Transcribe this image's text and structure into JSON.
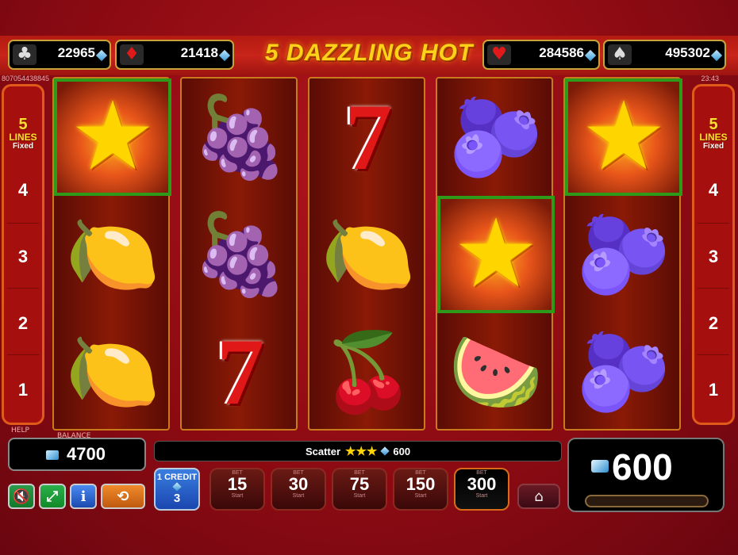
{
  "title": "5 DAZZLING HOT",
  "jackpots": [
    {
      "suit": "club",
      "icon": "♣",
      "value": "22965"
    },
    {
      "suit": "diamond",
      "icon": "♦",
      "value": "21418"
    },
    {
      "suit": "heart",
      "icon": "♥",
      "value": "284586"
    },
    {
      "suit": "spade",
      "icon": "♠",
      "value": "495302"
    }
  ],
  "top_left_id": "807054438845",
  "clock": "23:43",
  "side": {
    "lines_count": "5",
    "lines_word": "LINES",
    "lines_mode": "Fixed",
    "numbers": [
      "4",
      "3",
      "2",
      "1"
    ]
  },
  "reels": [
    [
      "star",
      "lemon",
      "lemon"
    ],
    [
      "grapes",
      "grapes",
      "seven"
    ],
    [
      "seven",
      "lemon",
      "cherry"
    ],
    [
      "plum",
      "star",
      "watermelon"
    ],
    [
      "star",
      "plum",
      "plum"
    ]
  ],
  "highlighted": [
    [
      0,
      0
    ],
    [
      3,
      1
    ],
    [
      4,
      0
    ]
  ],
  "help_label": "HELP",
  "balance": {
    "label": "BALANCE",
    "value": "4700"
  },
  "scatter": {
    "label": "Scatter",
    "stars": "★★★",
    "value": "600"
  },
  "win": {
    "value": "600"
  },
  "credit": {
    "label": "1 CREDIT",
    "value": "3"
  },
  "bets": [
    {
      "label": "BET",
      "value": "15",
      "sub": "Start",
      "active": false
    },
    {
      "label": "BET",
      "value": "30",
      "sub": "Start",
      "active": false
    },
    {
      "label": "BET",
      "value": "75",
      "sub": "Start",
      "active": false
    },
    {
      "label": "BET",
      "value": "150",
      "sub": "Start",
      "active": false
    },
    {
      "label": "BET",
      "value": "300",
      "sub": "Start",
      "active": true
    }
  ],
  "colors": {
    "highlight": "#2e9a1a",
    "title": "#ffd21a",
    "accent": "#e05a1a"
  }
}
